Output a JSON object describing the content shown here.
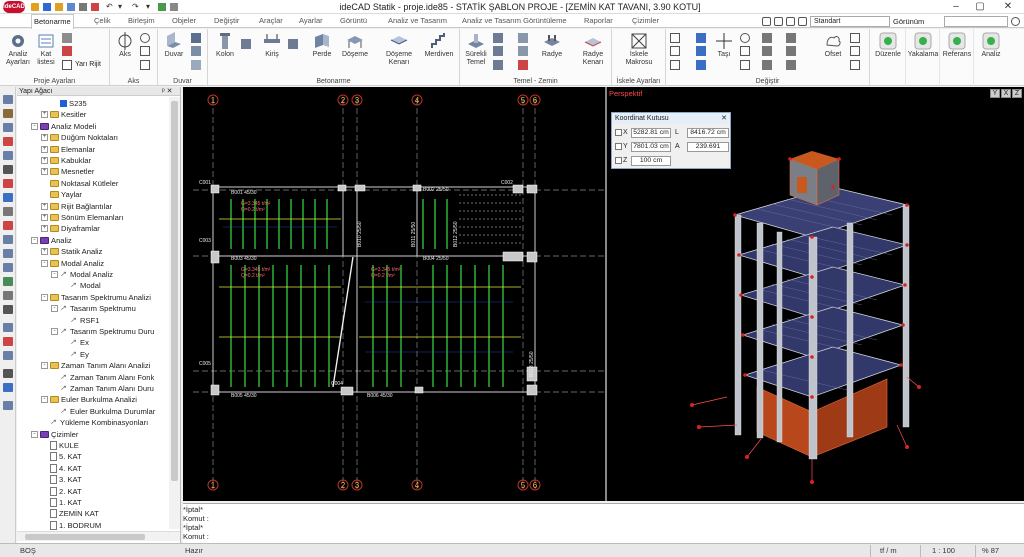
{
  "window": {
    "logo": "ideCAD",
    "title": "ideCAD Statik - proje.ide85 - STATİK ŞABLON PROJE - [ZEMİN KAT TAVANI,  3.90 KOTU]",
    "controls": [
      "–",
      "▢",
      "✕"
    ]
  },
  "tabs": [
    "Betonarme",
    "Çelik",
    "Birleşim",
    "Objeler",
    "Değiştir",
    "Araçlar",
    "Ayarlar",
    "Görüntü",
    "Analiz ve Tasarım",
    "Analiz ve Tasarım Görüntüleme",
    "Raporlar",
    "Çizimler"
  ],
  "active_tab": 0,
  "toolbar_right": {
    "style_select": "Standart",
    "view_label": "Görünüm"
  },
  "ribbon": {
    "groups": [
      {
        "label": "Proje Ayarları"
      },
      {
        "label": "Aks"
      },
      {
        "label": "Duvar"
      },
      {
        "label": "Betonarme"
      },
      {
        "label": "Temel - Zemin"
      },
      {
        "label": "İskele Ayarları"
      },
      {
        "label": "Değiştir"
      }
    ],
    "buttons": {
      "analiz_ayarlari": "Analiz\nAyarları",
      "kat_listesi": "Kat\nlistesi",
      "yari_rijit": "Yarı Rijit",
      "aks": "Aks",
      "duvar": "Duvar",
      "kolon": "Kolon",
      "kiris": "Kiriş",
      "perde": "Perde",
      "doseme": "Döşeme",
      "doseme_kenari": "Döşeme\nKenarı",
      "merdiven": "Merdiven",
      "surekli_temel": "Sürekli\nTemel",
      "radye": "Radye",
      "radye_kenari": "Radye\nKenarı",
      "iskele_makrosu": "İskele\nMakrosu",
      "tasi": "Taşı",
      "ofset": "Ofset",
      "duzenle": "Düzenle",
      "yakalama": "Yakalama",
      "referans": "Referans",
      "analiz": "Analiz"
    }
  },
  "tree": {
    "header": "Yapı Ağacı",
    "nodes": [
      {
        "label": "S235",
        "level": 3,
        "icon": "steel"
      },
      {
        "label": "Kesitler",
        "level": 2,
        "icon": "folder",
        "exp": "+"
      },
      {
        "label": "Analiz Modeli",
        "level": 1,
        "icon": "model",
        "exp": "-"
      },
      {
        "label": "Düğüm Noktaları",
        "level": 2,
        "icon": "folder",
        "exp": "+"
      },
      {
        "label": "Elemanlar",
        "level": 2,
        "icon": "folder",
        "exp": "+"
      },
      {
        "label": "Kabuklar",
        "level": 2,
        "icon": "folder",
        "exp": "+"
      },
      {
        "label": "Mesnetler",
        "level": 2,
        "icon": "folder",
        "exp": "+"
      },
      {
        "label": "Noktasal Kütleler",
        "level": 2,
        "icon": "folder"
      },
      {
        "label": "Yaylar",
        "level": 2,
        "icon": "folder"
      },
      {
        "label": "Rijit Bağlantılar",
        "level": 2,
        "icon": "folder",
        "exp": "+"
      },
      {
        "label": "Sönüm Elemanları",
        "level": 2,
        "icon": "folder",
        "exp": "+"
      },
      {
        "label": "Diyaframlar",
        "level": 2,
        "icon": "folder",
        "exp": "+"
      },
      {
        "label": "Analiz",
        "level": 1,
        "icon": "model",
        "exp": "-"
      },
      {
        "label": "Statik Analiz",
        "level": 2,
        "icon": "folder",
        "exp": "+"
      },
      {
        "label": "Modal Analiz",
        "level": 2,
        "icon": "folder",
        "exp": "-"
      },
      {
        "label": "Modal Analiz",
        "level": 3,
        "icon": "wave",
        "exp": "-"
      },
      {
        "label": "Modal",
        "level": 4,
        "icon": "wave"
      },
      {
        "label": "Tasarım Spektrumu Analizi",
        "level": 2,
        "icon": "folder",
        "exp": "-"
      },
      {
        "label": "Tasarım Spektrumu",
        "level": 3,
        "icon": "wave",
        "exp": "-"
      },
      {
        "label": "RSF1",
        "level": 4,
        "icon": "wave"
      },
      {
        "label": "Tasarım Spektrumu Duru",
        "level": 3,
        "icon": "wave",
        "exp": "-"
      },
      {
        "label": "Ex",
        "level": 4,
        "icon": "wave"
      },
      {
        "label": "Ey",
        "level": 4,
        "icon": "wave"
      },
      {
        "label": "Zaman Tanım Alanı Analizi",
        "level": 2,
        "icon": "folder",
        "exp": "-"
      },
      {
        "label": "Zaman Tanım Alanı Fonk",
        "level": 3,
        "icon": "wave"
      },
      {
        "label": "Zaman Tanım Alanı Duru",
        "level": 3,
        "icon": "wave"
      },
      {
        "label": "Euler Burkulma Analizi",
        "level": 2,
        "icon": "folder",
        "exp": "-"
      },
      {
        "label": "Euler Burkulma Durumlar",
        "level": 3,
        "icon": "wave"
      },
      {
        "label": "Yükleme Kombinasyonları",
        "level": 2,
        "icon": "wave"
      },
      {
        "label": "Çizimler",
        "level": 1,
        "icon": "model",
        "exp": "-"
      },
      {
        "label": "KULE",
        "level": 2,
        "icon": "doc"
      },
      {
        "label": "5. KAT",
        "level": 2,
        "icon": "doc"
      },
      {
        "label": "4. KAT",
        "level": 2,
        "icon": "doc"
      },
      {
        "label": "3. KAT",
        "level": 2,
        "icon": "doc"
      },
      {
        "label": "2. KAT",
        "level": 2,
        "icon": "doc"
      },
      {
        "label": "1. KAT",
        "level": 2,
        "icon": "doc"
      },
      {
        "label": "ZEMİN KAT",
        "level": 2,
        "icon": "doc"
      },
      {
        "label": "1. BODRUM",
        "level": 2,
        "icon": "doc"
      }
    ]
  },
  "plan": {
    "axis_top": [
      "1",
      "2",
      "3",
      "4",
      "5",
      "6"
    ],
    "axis_bottom": [
      "1",
      "2",
      "3",
      "4",
      "5",
      "6"
    ],
    "labels": {
      "b001": "B001 45/30",
      "b002": "B002 25/50",
      "b003": "B003 45/30",
      "b004": "B004 25/50",
      "b005": "B005 45/30",
      "b006": "B006 45/30",
      "c001": "C001",
      "c002": "C002",
      "c003": "C003",
      "c004": "C004",
      "c005": "C005",
      "b010": "B010 25/50",
      "b011": "B011 25/50",
      "b012": "B012 25/50",
      "b013": "B013 25/50",
      "load1": "G=3.345 t/m²",
      "load2": "Q=0.2 t/m²",
      "load3": "G=3.345 t/m²",
      "load4": "Q=0.2 t/m²",
      "load5": "G=3.345 t/m²",
      "load6": "Q=0.2 t/m²"
    }
  },
  "perspective": {
    "title": "Perspektif",
    "view_buttons": [
      "Y",
      "X",
      "Z"
    ],
    "coord_box": {
      "title": "Koordinat Kutusu",
      "x_label": "X",
      "x_val": "5282.81 cm",
      "l_label": "L",
      "l_val": "8416.72 cm",
      "y_label": "Y",
      "y_val": "7801.03 cm",
      "a_label": "A",
      "a_val": "239.691",
      "z_label": "Z",
      "z_val": "100 cm"
    }
  },
  "command": {
    "lines": [
      "*İptal*",
      "Komut :",
      "*İptal*",
      "Komut :"
    ]
  },
  "status": {
    "left": "BOŞ",
    "center": "Hazır",
    "unit": "tf / m",
    "scale": "1 : 100",
    "zoom": "% 87"
  },
  "colors": {
    "accent": "#1e5fd6",
    "active_tab": "#ffffff",
    "logo": "#c8102e",
    "persp_title": "#ff4a4a"
  }
}
